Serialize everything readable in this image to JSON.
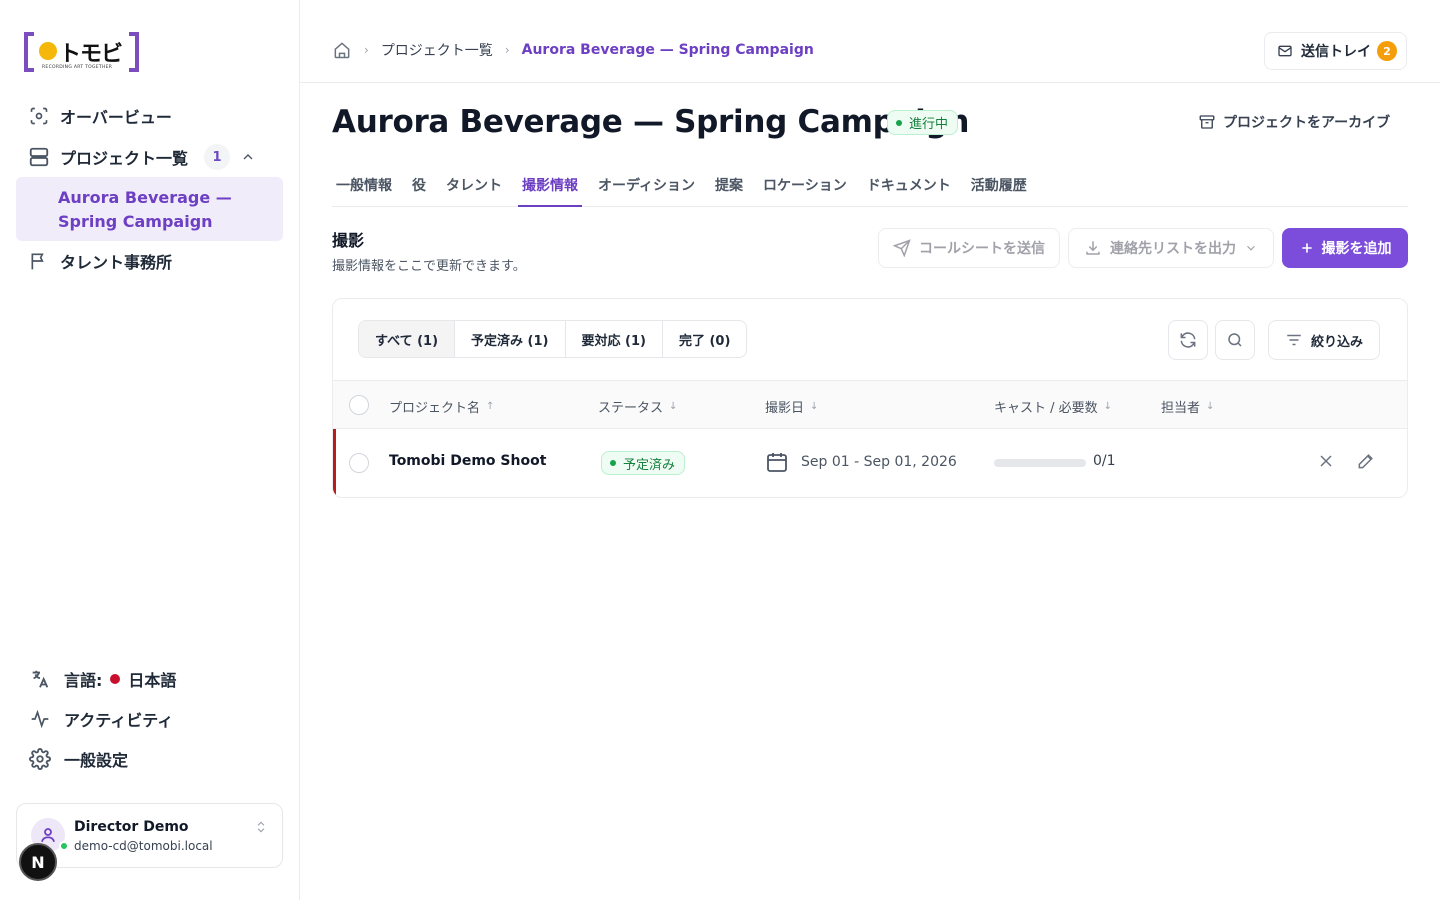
{
  "logo": {
    "word": "トモビ",
    "tagline": "RECORDING ART TOGETHER"
  },
  "sidebar": {
    "items": [
      {
        "label": "オーバービュー",
        "icon": "scan-icon"
      },
      {
        "label": "プロジェクト一覧",
        "icon": "projects-icon",
        "badge": "1"
      },
      {
        "label": "タレント事務所",
        "icon": "flag-icon"
      }
    ],
    "sub_item": "Aurora Beverage — Spring Campaign",
    "bottom": {
      "language_label": "言語:",
      "language_value": "日本語",
      "activity": "アクティビティ",
      "settings": "一般設定"
    },
    "user": {
      "name": "Director Demo",
      "email": "demo-cd@tomobi.local"
    },
    "dev_badge": "N"
  },
  "topbar": {
    "breadcrumb": [
      "プロジェクト一覧",
      "Aurora Beverage — Spring Campaign"
    ],
    "outbox_label": "送信トレイ",
    "outbox_count": "2"
  },
  "header": {
    "title": "Aurora Beverage — Spring Campaign",
    "status": "進行中",
    "archive": "プロジェクトをアーカイブ"
  },
  "tabs": [
    {
      "label": "一般情報",
      "active": false
    },
    {
      "label": "役",
      "active": false
    },
    {
      "label": "タレント",
      "active": false
    },
    {
      "label": "撮影情報",
      "active": true
    },
    {
      "label": "オーディション",
      "active": false
    },
    {
      "label": "提案",
      "active": false
    },
    {
      "label": "ロケーション",
      "active": false
    },
    {
      "label": "ドキュメント",
      "active": false
    },
    {
      "label": "活動履歴",
      "active": false
    }
  ],
  "section": {
    "title": "撮影",
    "subtitle": "撮影情報をここで更新できます。",
    "send_callsheet": "コールシートを送信",
    "export_contacts": "連絡先リストを出力",
    "add_shoot": "撮影を追加"
  },
  "filters": {
    "segments": [
      "すべて (1)",
      "予定済み (1)",
      "要対応 (1)",
      "完了 (0)"
    ],
    "filter_label": "絞り込み"
  },
  "table": {
    "headers": [
      "プロジェクト名",
      "ステータス",
      "撮影日",
      "キャスト / 必要数",
      "担当者"
    ],
    "rows": [
      {
        "name": "Tomobi Demo Shoot",
        "status": "予定済み",
        "date": "Sep 01 - Sep 01, 2026",
        "cast": "0/1",
        "cast_progress": 0
      }
    ]
  },
  "colors": {
    "accent": "#7c4ddb",
    "success": "#16a34a",
    "warning": "#f59e0b",
    "row_marker": "#b91c1c"
  }
}
